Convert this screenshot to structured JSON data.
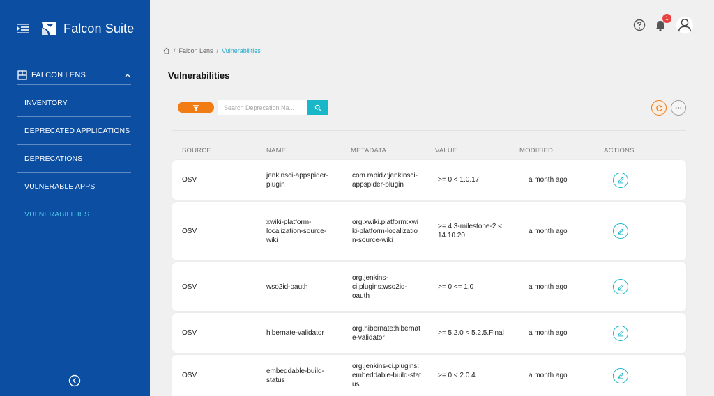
{
  "app": {
    "title": "Falcon Suite"
  },
  "sidebar": {
    "section_label": "FALCON LENS",
    "items": [
      {
        "label": "INVENTORY",
        "active": false
      },
      {
        "label": "DEPRECATED APPLICATIONS",
        "active": false
      },
      {
        "label": "DEPRECATIONS",
        "active": false
      },
      {
        "label": "VULNERABLE APPS",
        "active": false
      },
      {
        "label": "VULNERABILITIES",
        "active": true
      }
    ]
  },
  "header": {
    "notification_count": "1"
  },
  "breadcrumb": {
    "sep": "/",
    "items": [
      "Falcon Lens",
      "Vulnerabilities"
    ]
  },
  "page": {
    "title": "Vulnerabilities"
  },
  "search": {
    "placeholder": "Search Deprecation Na..."
  },
  "table": {
    "columns": [
      "SOURCE",
      "NAME",
      "METADATA",
      "VALUE",
      "MODIFIED",
      "ACTIONS"
    ],
    "rows": [
      {
        "source": "OSV",
        "name": "jenkinsci-appspider-plugin",
        "metadata": "com.rapid7:jenkinsci-appspider-plugin",
        "value": ">= 0 < 1.0.17",
        "modified": "a month ago"
      },
      {
        "source": "OSV",
        "name": "xwiki-platform-localization-source-wiki",
        "metadata": "org.xwiki.platform:xwiki-platform-localization-source-wiki",
        "value": ">= 4.3-milestone-2 < 14.10.20",
        "modified": "a month ago"
      },
      {
        "source": "OSV",
        "name": "wso2id-oauth",
        "metadata": "org.jenkins-ci.plugins:wso2id-oauth",
        "value": ">= 0 <= 1.0",
        "modified": "a month ago"
      },
      {
        "source": "OSV",
        "name": "hibernate-validator",
        "metadata": "org.hibernate:hibernate-validator",
        "value": ">= 5.2.0 < 5.2.5.Final",
        "modified": "a month ago"
      },
      {
        "source": "OSV",
        "name": "embeddable-build-status",
        "metadata": "org.jenkins-ci.plugins:embeddable-build-status",
        "value": ">= 0 < 2.0.4",
        "modified": "a month ago"
      }
    ]
  },
  "colors": {
    "sidebar": "#0b4ea2",
    "accent": "#19b7c8",
    "orange": "#f07c13",
    "badge": "#e94040"
  },
  "icons": [
    "menu-icon",
    "falcon-logo",
    "grid-icon",
    "chevron-up-icon",
    "collapse-icon",
    "help-icon",
    "bell-icon",
    "user-icon",
    "home-icon",
    "filter-icon",
    "search-icon",
    "refresh-icon",
    "more-icon",
    "edit-icon"
  ]
}
